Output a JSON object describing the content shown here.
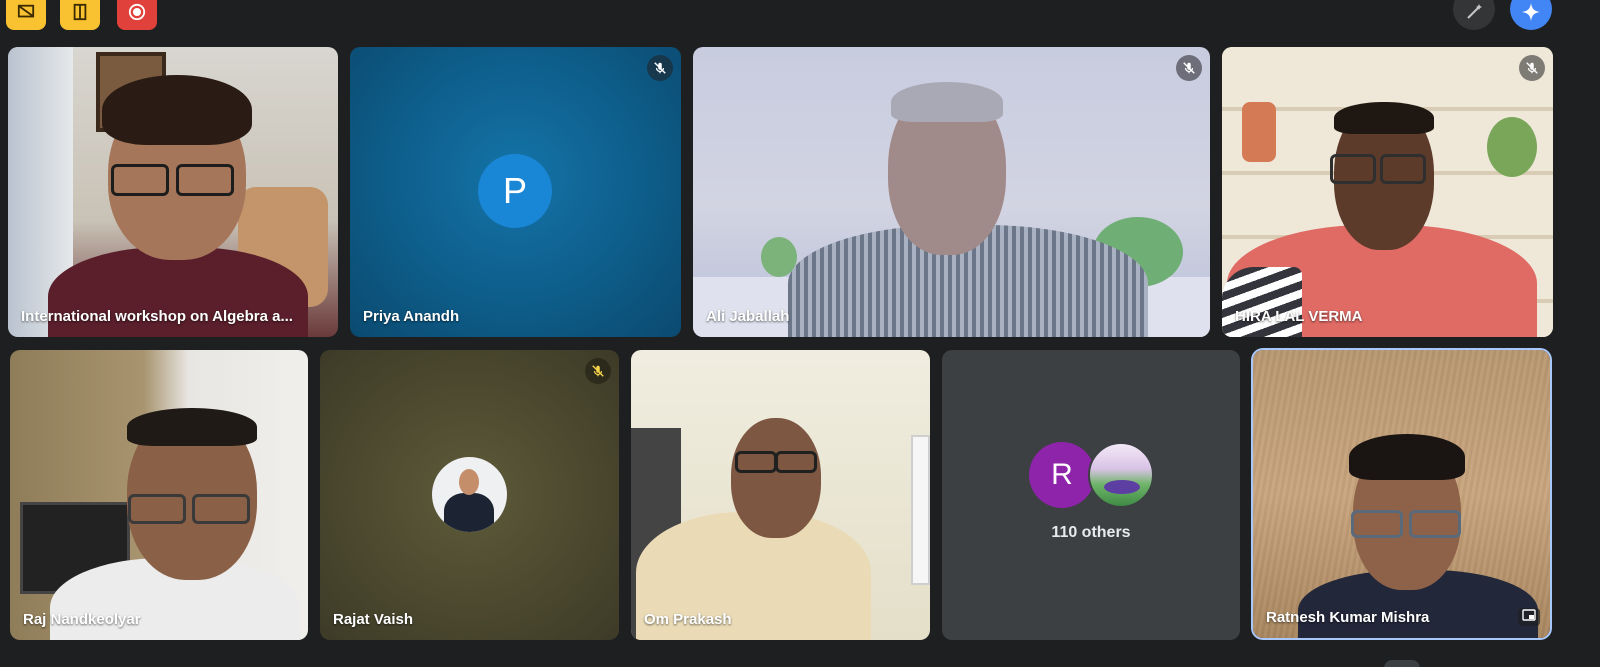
{
  "toolbar": {
    "left_buttons": [
      {
        "icon": "whiteboard-icon",
        "color": "#f9c231"
      },
      {
        "icon": "breakout-room-icon",
        "color": "#f9c231"
      },
      {
        "icon": "record-icon",
        "color": "#e0413a"
      }
    ],
    "right_buttons": [
      {
        "icon": "magic-pen-icon"
      },
      {
        "icon": "gemini-sparkle-icon",
        "color": "#4285f4"
      }
    ]
  },
  "participants": [
    {
      "name": "International workshop on Algebra a...",
      "muted": false
    },
    {
      "name": "Priya Anandh",
      "muted": true,
      "avatar_letter": "P",
      "avatar_color": "#1a86d6"
    },
    {
      "name": "Ali Jaballah",
      "muted": true
    },
    {
      "name": "HIRA LAL VERMA",
      "muted": true
    },
    {
      "name": "Raj Nandkeolyar",
      "muted": false
    },
    {
      "name": "Rajat Vaish",
      "muted": true
    },
    {
      "name": "Om Prakash",
      "muted": false
    },
    {
      "name": "Ratnesh Kumar Mishra",
      "muted": false
    }
  ],
  "others_tile": {
    "label": "110 others",
    "avatar_letter": "R",
    "avatar_color": "#8e24aa"
  },
  "participant_count_badge": "110"
}
